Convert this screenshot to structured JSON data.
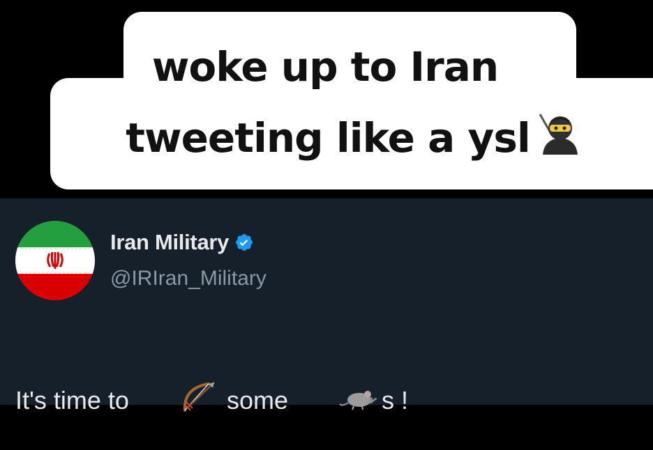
{
  "caption": {
    "line1": "woke up to Iran",
    "line2": "tweeting like a ysl",
    "emoji_icon": "ninja-icon"
  },
  "tweet": {
    "display_name": "Iran Military",
    "verified_icon": "verified-badge-icon",
    "handle": "@IRIran_Military",
    "avatar_icon": "iran-flag-icon",
    "text_part1": "It's time to",
    "emoji1_icon": "bow-and-arrow-icon",
    "text_part2": "some",
    "emoji2_icon": "rat-icon",
    "text_part3": "s !"
  },
  "colors": {
    "background": "#000000",
    "caption_box": "#ffffff",
    "tweet_background": "#15202b",
    "name_text": "#e7e9ea",
    "handle_text": "#8b98a5",
    "verified_blue": "#1d9bf0"
  }
}
